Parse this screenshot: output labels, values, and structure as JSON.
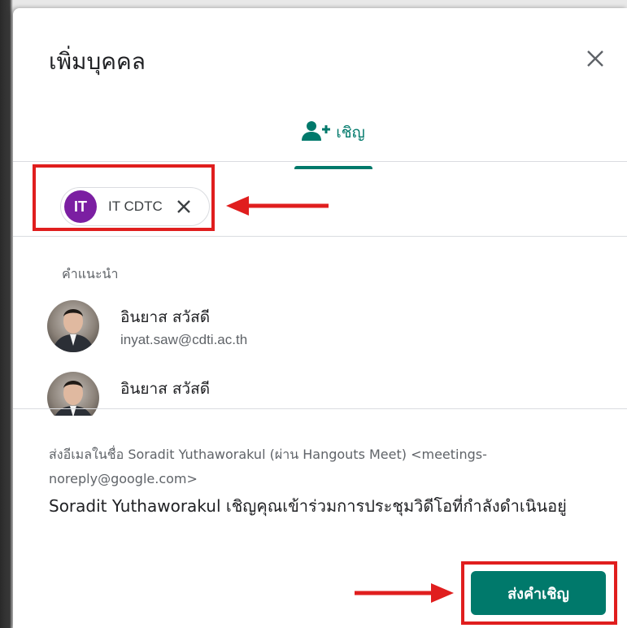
{
  "dialog": {
    "title": "เพิ่มบุคคล",
    "tab_label": "เชิญ"
  },
  "chip": {
    "initials": "IT",
    "label": "IT CDTC",
    "avatar_color": "#7b1fa2"
  },
  "suggestions": {
    "label": "คำแนะนำ",
    "people": [
      {
        "name": "อินยาส สวัสดี",
        "email": "inyat.saw@cdti.ac.th"
      },
      {
        "name": "อินยาส สวัสดี",
        "email": ""
      }
    ]
  },
  "footer": {
    "from_text": "ส่งอีเมลในชื่อ Soradit Yuthaworakul (ผ่าน Hangouts Meet) <meetings-noreply@google.com>",
    "message": "Soradit Yuthaworakul เชิญคุณเข้าร่วมการประชุมวิดีโอที่กำลังดำเนินอยู่",
    "send_label": "ส่งคำเชิญ"
  },
  "colors": {
    "accent": "#00796b",
    "highlight": "#e01e1e"
  }
}
